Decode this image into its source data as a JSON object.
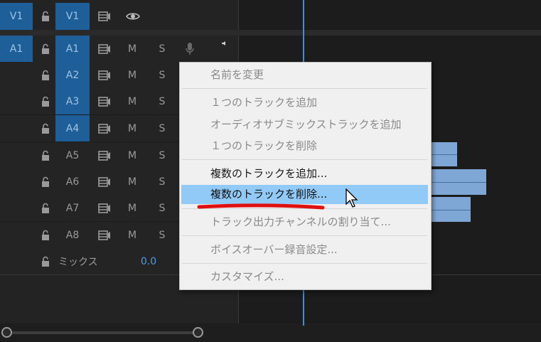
{
  "tracks": {
    "video": [
      {
        "target": "V1",
        "name": "V1"
      }
    ],
    "audio": [
      {
        "target": "A1",
        "name": "A1",
        "mute": "M",
        "solo": "S",
        "targeted": true
      },
      {
        "target": "",
        "name": "A2",
        "mute": "M",
        "solo": "S",
        "targeted": true
      },
      {
        "target": "",
        "name": "A3",
        "mute": "M",
        "solo": "S",
        "targeted": true
      },
      {
        "target": "",
        "name": "A4",
        "mute": "M",
        "solo": "S",
        "targeted": true
      },
      {
        "target": "",
        "name": "A5",
        "mute": "M",
        "solo": "S",
        "targeted": false
      },
      {
        "target": "",
        "name": "A6",
        "mute": "M",
        "solo": "S",
        "targeted": false
      },
      {
        "target": "",
        "name": "A7",
        "mute": "M",
        "solo": "S",
        "targeted": false
      },
      {
        "target": "",
        "name": "A8",
        "mute": "M",
        "solo": "S",
        "targeted": false
      }
    ],
    "mix": {
      "label": "ミックス",
      "value": "0.0"
    }
  },
  "context_menu": {
    "items": [
      {
        "label": "名前を変更",
        "enabled": false
      },
      {
        "label": "１つのトラックを追加",
        "enabled": false
      },
      {
        "label": "オーディオサブミックストラックを追加",
        "enabled": false
      },
      {
        "label": "１つのトラックを削除",
        "enabled": false
      },
      {
        "label": "複数のトラックを追加...",
        "enabled": true
      },
      {
        "label": "複数のトラックを削除...",
        "enabled": true,
        "highlighted": true
      },
      {
        "label": "トラック出力チャンネルの割り当て...",
        "enabled": false
      },
      {
        "label": "ボイスオーバー録音設定...",
        "enabled": false
      },
      {
        "label": "カスタマイズ...",
        "enabled": false
      }
    ]
  },
  "colors": {
    "target_blue": "#1f5f99",
    "playhead": "#3d8de0",
    "menu_highlight": "#91c9f7",
    "annotation": "#e01010"
  }
}
